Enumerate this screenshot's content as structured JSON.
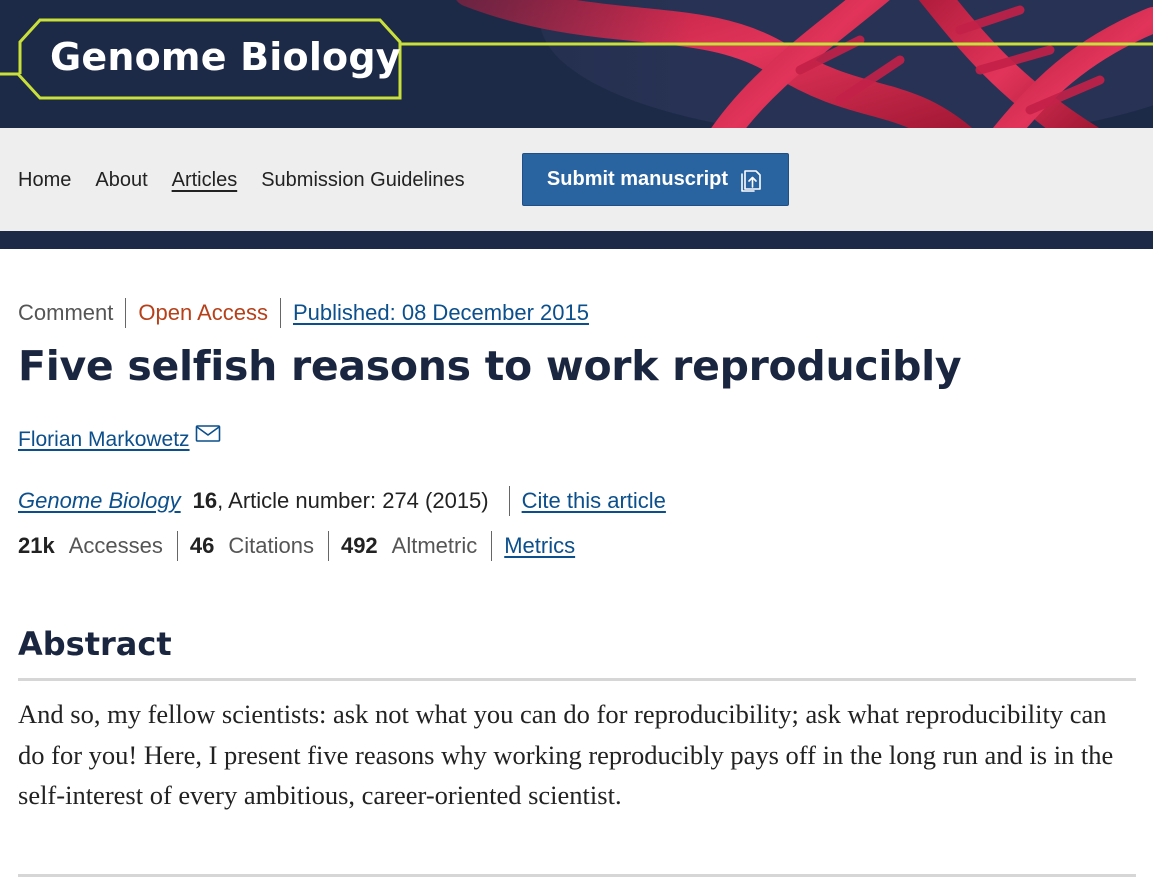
{
  "header": {
    "journal_name": "Genome Biology",
    "colors": {
      "banner_bg": "#1d2a47",
      "accent_lime": "#c9e03a",
      "dna_red": "#d8254a"
    }
  },
  "nav": {
    "items": [
      {
        "label": "Home",
        "active": false
      },
      {
        "label": "About",
        "active": false
      },
      {
        "label": "Articles",
        "active": true
      },
      {
        "label": "Submission Guidelines",
        "active": false
      }
    ],
    "submit_label": "Submit manuscript",
    "submit_icon": "upload-document-icon"
  },
  "article": {
    "type": "Comment",
    "access": "Open Access",
    "published": "Published: 08 December 2015",
    "title": "Five selfish reasons to work reproducibly",
    "author": "Florian Markowetz",
    "author_icon": "mail-icon",
    "journal": "Genome Biology",
    "volume": "16",
    "article_number": ", Article number: 274 (2015)",
    "cite_label": "Cite this article"
  },
  "metrics": [
    {
      "value": "21k",
      "label": "Accesses"
    },
    {
      "value": "46",
      "label": "Citations"
    },
    {
      "value": "492",
      "label": "Altmetric"
    }
  ],
  "metrics_link": "Metrics",
  "abstract": {
    "heading": "Abstract",
    "text": "And so, my fellow scientists: ask not what you can do for reproducibility; ask what reproducibility can do for you! Here, I present five reasons why working reproducibly pays off in the long run and is in the self-interest of every ambitious, career-oriented scientist."
  }
}
